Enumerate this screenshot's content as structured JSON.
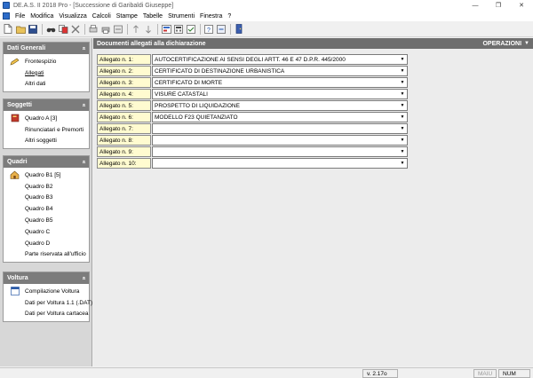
{
  "window": {
    "title": "DE.A.S. II 2018 Pro - [Successione di Garibaldi Giuseppe]",
    "controls": [
      "—",
      "❐",
      "✕"
    ]
  },
  "menubar": {
    "items": [
      "File",
      "Modifica",
      "Visualizza",
      "Calcoli",
      "Stampe",
      "Tabelle",
      "Strumenti",
      "Finestra",
      "?"
    ]
  },
  "sidebar": {
    "collapse_glyph": "«",
    "panels": {
      "dati_generali": {
        "title": "Dati Generali",
        "items": [
          "Frontespizio",
          "Allegati",
          "Altri dati"
        ]
      },
      "soggetti": {
        "title": "Soggetti",
        "items": [
          "Quadro A [3]",
          "Rinunciatari e Premorti",
          "Altri soggetti"
        ]
      },
      "quadri": {
        "title": "Quadri",
        "items": [
          "Quadro B1 [5]",
          "Quadro B2",
          "Quadro B3",
          "Quadro B4",
          "Quadro B5",
          "Quadro C",
          "Quadro D",
          "Parte riservata all'ufficio"
        ]
      },
      "voltura": {
        "title": "Voltura",
        "items": [
          "Compilazione Voltura",
          "Dati per Voltura 1.1 (.DAT)",
          "Dati per Voltura cartacea"
        ]
      }
    }
  },
  "main": {
    "title": "Documenti allegati alla dichiarazione",
    "operations_label": "OPERAZIONI",
    "operations_arrow": "▼",
    "dropdown_arrow": "▼",
    "rows": [
      {
        "label": "Allegato n. 1:",
        "value": "AUTOCERTIFICAZIONE AI SENSI DEGLI ARTT. 46 E 47 D.P.R. 445/2000"
      },
      {
        "label": "Allegato n. 2:",
        "value": "CERTIFICATO DI DESTINAZIONE URBANISTICA"
      },
      {
        "label": "Allegato n. 3:",
        "value": "CERTIFICATO DI MORTE"
      },
      {
        "label": "Allegato n. 4:",
        "value": "VISURE CATASTALI"
      },
      {
        "label": "Allegato n. 5:",
        "value": "PROSPETTO DI LIQUIDAZIONE"
      },
      {
        "label": "Allegato n. 6:",
        "value": "MODELLO F23 QUIETANZIATO"
      },
      {
        "label": "Allegato n. 7:",
        "value": ""
      },
      {
        "label": "Allegato n. 8:",
        "value": ""
      },
      {
        "label": "Allegato n. 9:",
        "value": ""
      },
      {
        "label": "Allegato n. 10:",
        "value": ""
      }
    ]
  },
  "statusbar": {
    "version": "v. 2.17o",
    "maiu": "MAIU",
    "num": "NUM"
  },
  "colors": {
    "panel_header": "#7c7c7c",
    "main_header": "#6e6e6e",
    "label_bg": "#fffbd0"
  }
}
